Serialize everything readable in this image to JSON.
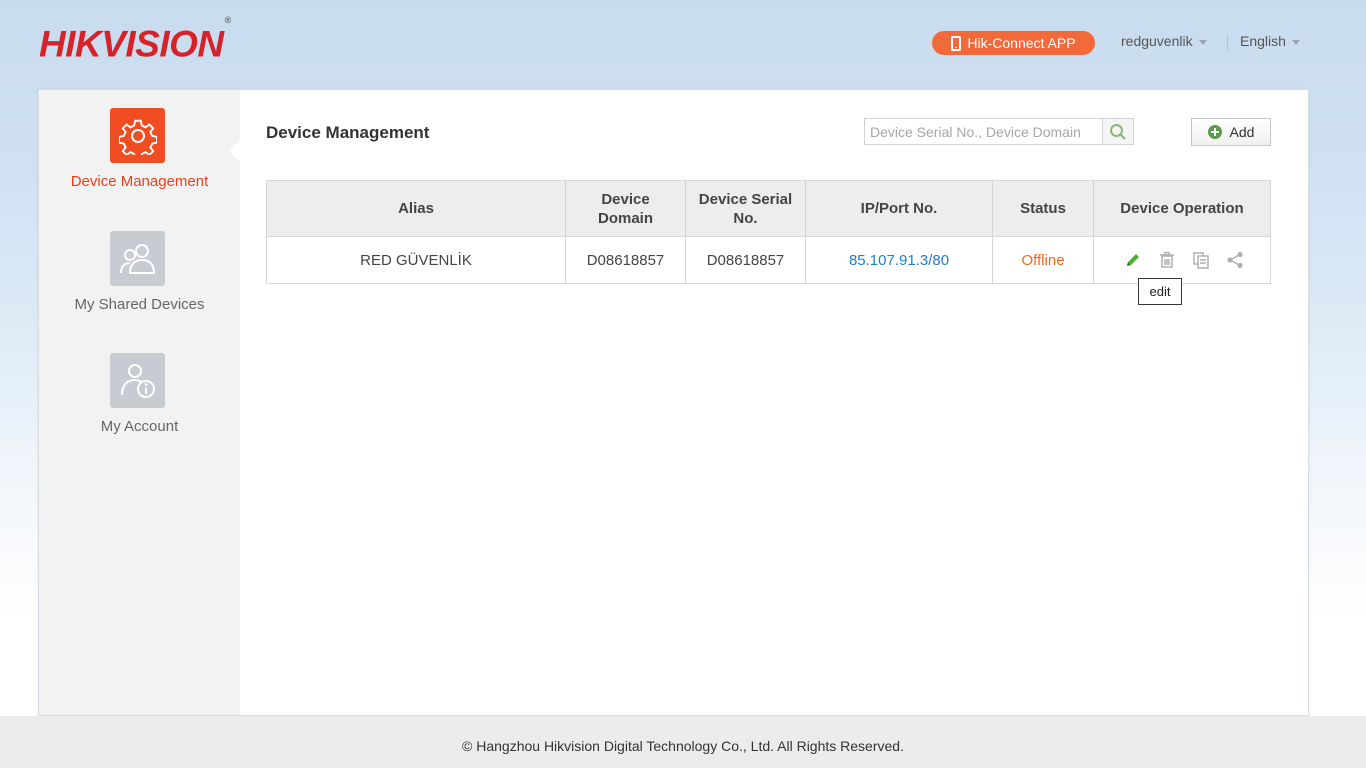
{
  "header": {
    "logo_text": "HIKVISION",
    "logo_mark": "®",
    "app_button_label": "Hik-Connect APP",
    "username": "redguvenlik",
    "language": "English"
  },
  "sidebar": {
    "items": [
      {
        "label": "Device Management",
        "icon": "gear-icon",
        "active": true
      },
      {
        "label": "My Shared Devices",
        "icon": "users-icon",
        "active": false
      },
      {
        "label": "My Account",
        "icon": "account-info-icon",
        "active": false
      }
    ]
  },
  "main": {
    "title": "Device Management",
    "search": {
      "placeholder": "Device Serial No., Device Domain",
      "value": ""
    },
    "add_label": "Add",
    "table": {
      "columns": [
        "Alias",
        "Device Domain",
        "Device Serial No.",
        "IP/Port No.",
        "Status",
        "Device Operation"
      ],
      "rows": [
        {
          "alias": "RED GÜVENLİK",
          "domain": "D08618857",
          "serial": "D08618857",
          "ip_port": "85.107.91.3/80",
          "status": "Offline",
          "operations": [
            "edit-icon",
            "delete-icon",
            "copy-icon",
            "share-icon"
          ]
        }
      ]
    },
    "tooltip": "edit"
  },
  "colors": {
    "brand_red": "#d4242a",
    "accent_orange": "#f04d22",
    "link_blue": "#1f7fc4",
    "offline_orange": "#f06a1c",
    "edit_green": "#4caf2f"
  },
  "footer": {
    "copyright": "© Hangzhou Hikvision Digital Technology Co., Ltd. All Rights Reserved."
  }
}
